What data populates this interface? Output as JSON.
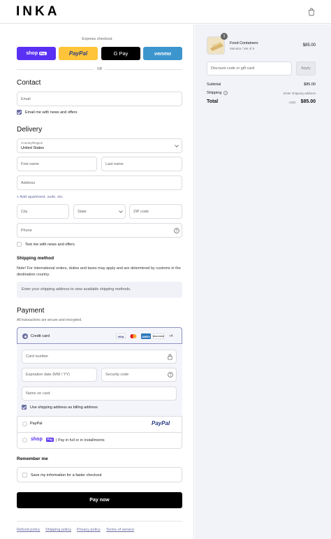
{
  "header": {
    "logo": "INKA"
  },
  "express": {
    "title": "Express checkout",
    "or": "OR",
    "shop_label": "shop",
    "shop_pay": "Pay",
    "paypal_label": "PayPal",
    "gpay_label": "G Pay",
    "venmo_label": "venmo"
  },
  "contact": {
    "title": "Contact",
    "email_placeholder": "Email",
    "news_label": "Email me with news and offers"
  },
  "delivery": {
    "title": "Delivery",
    "country_label": "Country/Region",
    "country_value": "United States",
    "first_name": "First name",
    "last_name": "Last name",
    "address": "Address",
    "add_apartment": "+ Add apartment, suite, etc.",
    "city": "City",
    "state": "State",
    "zip": "ZIP code",
    "phone": "Phone",
    "text_label": "Text me with news and offers"
  },
  "shipping": {
    "title": "Shipping method",
    "note": "Note! For international orders, duties and taxes may apply and are determined by customs in the destination country.",
    "notice": "Enter your shipping address to view available shipping methods."
  },
  "payment": {
    "title": "Payment",
    "subtitle": "All transactions are secure and encrypted.",
    "credit_card": "Credit card",
    "card_more": "+4",
    "card_number": "Card number",
    "expiration": "Expiration date (MM / YY)",
    "security": "Security code",
    "name_on_card": "Name on card",
    "billing_label": "Use shipping address as billing address",
    "paypal": "PayPal",
    "paypal_logo": "PayPal",
    "shop_label": "shop",
    "shop_pay": "Pay",
    "shop_installments": "| Pay in full or in installments",
    "icons": [
      "VISA",
      "MC",
      "AMEX",
      "DISCOVER"
    ]
  },
  "remember": {
    "title": "Remember me",
    "save_label": "Save my information for a faster checkout"
  },
  "pay_button": "Pay now",
  "footer": {
    "links": [
      "Refund policy",
      "Shipping policy",
      "Privacy policy",
      "Terms of service"
    ]
  },
  "summary": {
    "item": {
      "qty": "1",
      "name": "Food Containers",
      "variant": "Manuka / Set of 6",
      "price": "$85.00"
    },
    "discount_placeholder": "Discount code or gift card",
    "apply": "Apply",
    "subtotal_label": "Subtotal",
    "subtotal": "$85.00",
    "shipping_label": "Shipping",
    "shipping_value": "Enter shipping address",
    "total_label": "Total",
    "currency": "USD",
    "total": "$85.00"
  },
  "colors": {
    "accent": "#6b6fa3",
    "shop_pay": "#5a31f4",
    "paypal": "#ffc439",
    "venmo": "#3d95ce",
    "pay_button": "#000000"
  }
}
